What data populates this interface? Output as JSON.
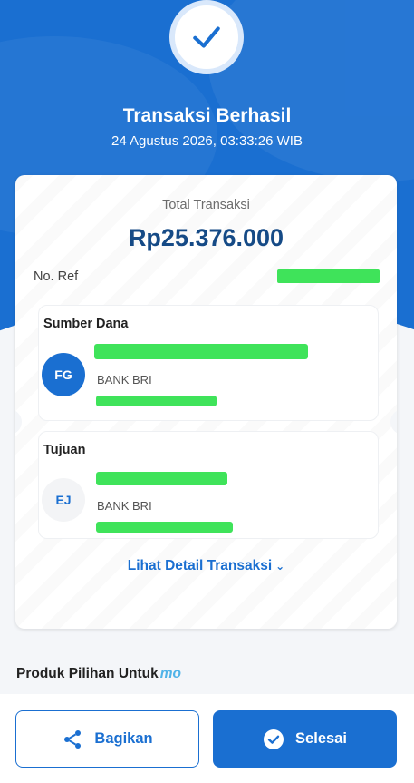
{
  "header": {
    "title": "Transaksi Berhasil",
    "datetime": "24 Agustus 2026, 03:33:26 WIB"
  },
  "receipt": {
    "total_label": "Total Transaksi",
    "total_amount": "Rp25.376.000",
    "ref_label": "No. Ref",
    "source": {
      "title": "Sumber Dana",
      "initials": "FG",
      "bank": "BANK BRI"
    },
    "destination": {
      "title": "Tujuan",
      "initials": "EJ",
      "bank": "BANK BRI"
    },
    "detail_link": "Lihat Detail Transaksi"
  },
  "promo": {
    "title": "Produk Pilihan Untuk",
    "brand": "mo"
  },
  "actions": {
    "share_label": "Bagikan",
    "done_label": "Selesai"
  },
  "colors": {
    "primary": "#1a6fd1",
    "amount": "#154a86",
    "redaction": "#3fe35a"
  },
  "icons": {
    "success": "check-icon",
    "share": "share-icon",
    "done": "check-circle-icon",
    "chevron": "chevron-down-icon"
  }
}
